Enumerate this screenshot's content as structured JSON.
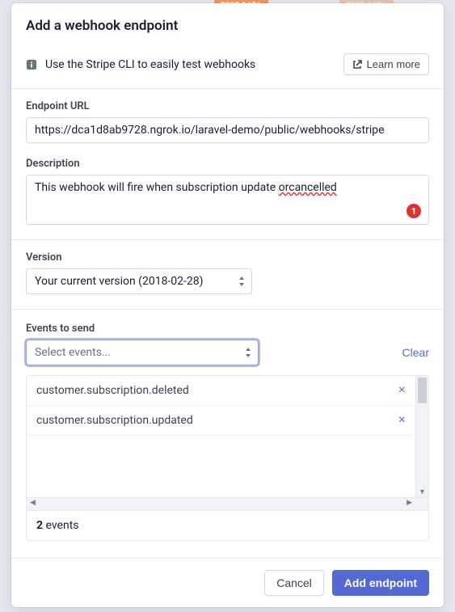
{
  "badges": {
    "test_data": "TEST DATA"
  },
  "modal": {
    "title": "Add a webhook endpoint",
    "tip": "Use the Stripe CLI to easily test webhooks",
    "learn_more": "Learn more"
  },
  "endpoint": {
    "label": "Endpoint URL",
    "value": "https://dca1d8ab9728.ngrok.io/laravel-demo/public/webhooks/stripe"
  },
  "description": {
    "label": "Description",
    "value_part1": "This webhook will fire when subscription update ",
    "value_misspelled": "orcancelled",
    "error_count": "1"
  },
  "version": {
    "label": "Version",
    "selected": "Your current version (2018-02-28)"
  },
  "events": {
    "label": "Events to send",
    "clear": "Clear",
    "placeholder": "Select events...",
    "items": [
      {
        "name": "customer.subscription.deleted"
      },
      {
        "name": "customer.subscription.updated"
      }
    ],
    "count_number": "2",
    "count_label": "  events"
  },
  "footer": {
    "cancel": "Cancel",
    "submit": "Add endpoint"
  }
}
